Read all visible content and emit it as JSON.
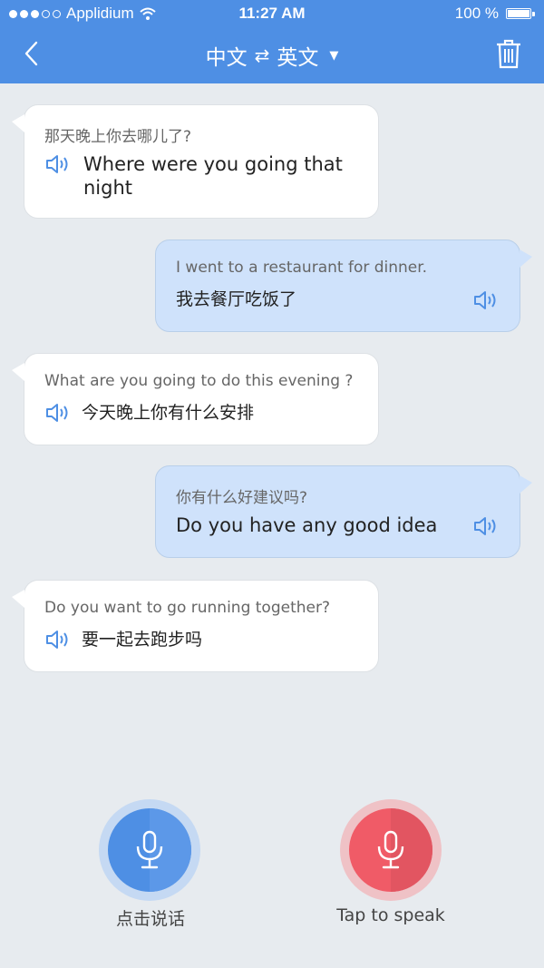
{
  "status_bar": {
    "carrier": "Applidium",
    "time": "11:27 AM",
    "battery": "100 %"
  },
  "header": {
    "source_lang": "中文",
    "swap_symbol": "⇄",
    "target_lang": "英文",
    "caret": "▼",
    "icons": [
      "back-chevron-icon",
      "trash-icon"
    ]
  },
  "messages": [
    {
      "side": "left",
      "source": "那天晚上你去哪儿了?",
      "translation_line1": "Where were you going that",
      "translation_line2": "night"
    },
    {
      "side": "right",
      "source": "I went to a restaurant for dinner.",
      "translation": "我去餐厅吃饭了"
    },
    {
      "side": "left",
      "source": "What are you going to do this evening ?",
      "translation": "今天晚上你有什么安排"
    },
    {
      "side": "right",
      "source": "你有什么好建议吗?",
      "translation": "Do you have any good idea"
    },
    {
      "side": "left",
      "source": "Do you want to go running together?",
      "translation": "要一起去跑步吗"
    }
  ],
  "bottom": {
    "left_label": "点击说话",
    "right_label": "Tap to speak"
  },
  "colors": {
    "header": "#4e8fe4",
    "left_mic": "#4e8fe4",
    "right_mic": "#ea5a66",
    "speaker_icon": "#4e8fe4"
  }
}
